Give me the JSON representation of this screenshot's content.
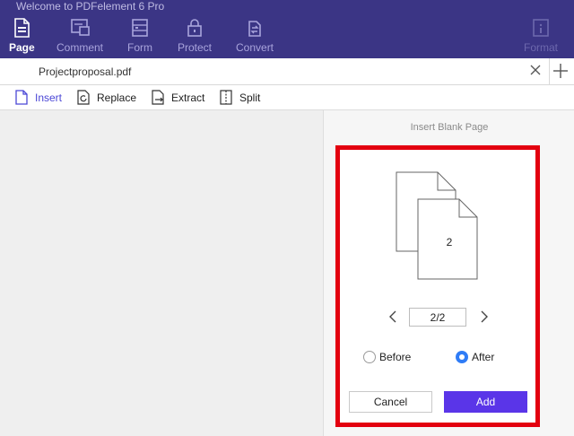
{
  "app": {
    "title": "Welcome to PDFelement 6 Pro"
  },
  "toolbar": {
    "items": [
      {
        "label": "Page",
        "icon": "page-icon"
      },
      {
        "label": "Comment",
        "icon": "comment-icon"
      },
      {
        "label": "Form",
        "icon": "form-icon"
      },
      {
        "label": "Protect",
        "icon": "lock-icon"
      },
      {
        "label": "Convert",
        "icon": "convert-icon"
      },
      {
        "label": "Format",
        "icon": "info-icon"
      }
    ]
  },
  "tab": {
    "filename": "Projectproposal.pdf"
  },
  "subtoolbar": {
    "items": [
      {
        "label": "Insert",
        "icon": "insert-page-icon"
      },
      {
        "label": "Replace",
        "icon": "replace-icon"
      },
      {
        "label": "Extract",
        "icon": "extract-icon"
      },
      {
        "label": "Split",
        "icon": "split-icon"
      }
    ]
  },
  "panel": {
    "title": "Insert Blank Page",
    "page_number_label": "2",
    "pager": {
      "value": "2/2"
    },
    "position_options": [
      {
        "label": "Before",
        "selected": false
      },
      {
        "label": "After",
        "selected": true
      }
    ],
    "cancel_label": "Cancel",
    "add_label": "Add"
  },
  "colors": {
    "toolbar_bg": "#3b3585",
    "accent": "#5a35e8",
    "highlight": "#e3000f",
    "radio_selected": "#2f7cf6"
  }
}
